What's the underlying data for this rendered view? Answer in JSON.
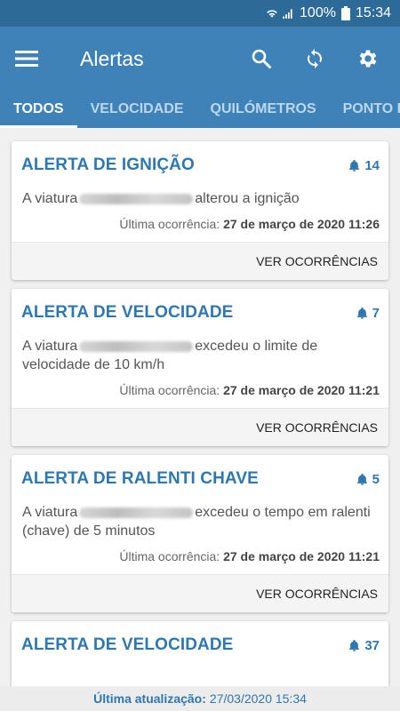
{
  "statusbar": {
    "battery": "100%",
    "time": "15:34"
  },
  "appbar": {
    "title": "Alertas"
  },
  "tabs": [
    {
      "label": "TODOS",
      "active": true
    },
    {
      "label": "VELOCIDADE",
      "active": false
    },
    {
      "label": "QUILÓMETROS",
      "active": false
    },
    {
      "label": "PONTO D",
      "active": false
    }
  ],
  "alerts": [
    {
      "title": "ALERTA DE IGNIÇÃO",
      "count": "14",
      "desc_prefix": "A viatura",
      "desc_suffix": "alterou a ignição",
      "meta_label": "Última ocorrência:",
      "meta_value": "27 de março de 2020 11:26",
      "action": "VER OCORRÊNCIAS"
    },
    {
      "title": "ALERTA DE VELOCIDADE",
      "count": "7",
      "desc_prefix": "A viatura",
      "desc_suffix": "excedeu o limite de velocidade de 10 km/h",
      "meta_label": "Última ocorrência:",
      "meta_value": "27 de março de 2020 11:21",
      "action": "VER OCORRÊNCIAS"
    },
    {
      "title": "ALERTA DE RALENTI CHAVE",
      "count": "5",
      "desc_prefix": "A viatura",
      "desc_suffix": "excedeu o tempo em ralenti (chave) de 5 minutos",
      "meta_label": "Última ocorrência:",
      "meta_value": "27 de março de 2020 11:21",
      "action": "VER OCORRÊNCIAS"
    },
    {
      "title": "ALERTA DE VELOCIDADE",
      "count": "37"
    }
  ],
  "footer": {
    "label": "Última atualização:",
    "value": "27/03/2020 15:34"
  },
  "colors": {
    "appbar": "#3e82b8",
    "statusbar": "#2e6a97",
    "accent": "#2f77b0"
  },
  "icons": [
    "menu-icon",
    "search-icon",
    "refresh-icon",
    "settings-icon",
    "bell-icon",
    "wifi-icon",
    "signal-icon",
    "battery-icon"
  ]
}
